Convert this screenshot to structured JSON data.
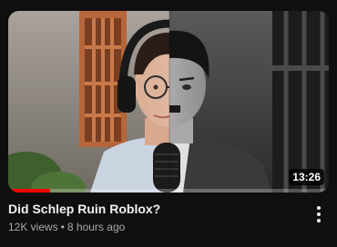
{
  "video": {
    "thumbnail_description_icon": "video-thumbnail",
    "duration": "13:26",
    "watch_progress": 0.13,
    "title": "Did Schlep Ruin Roblox?",
    "views": "12K views",
    "separator": "•",
    "age": "8 hours ago"
  },
  "colors": {
    "background": "#0f0f0f",
    "progress": "#ff0000",
    "title": "#f1f1f1",
    "subtitle": "#aaaaaa"
  },
  "icons": {
    "more": "vertical-dots-icon"
  }
}
